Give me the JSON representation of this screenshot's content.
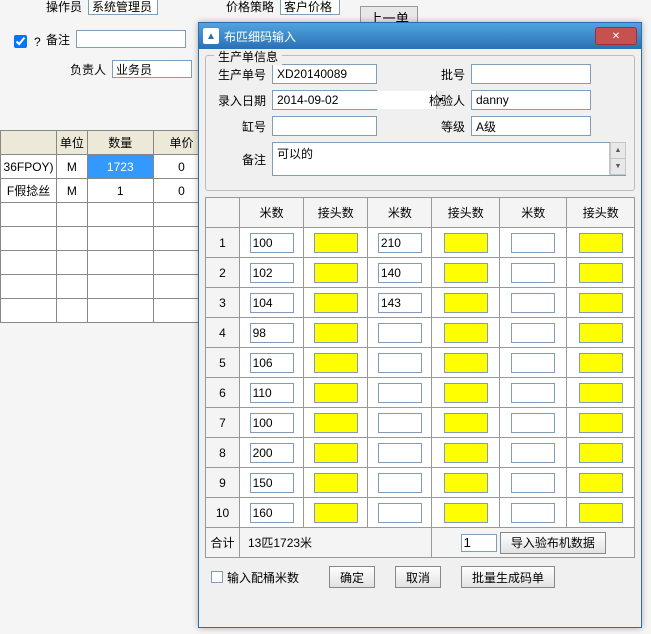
{
  "bg": {
    "operator_label": "操作员",
    "operator_value": "系统管理员",
    "price_strategy_label": "价格策略",
    "price_strategy_value": "客户价格",
    "prev_order_btn": "上一单",
    "checkbox_label": "?",
    "remark_label": "备注",
    "incharge_label": "负责人",
    "incharge_value": "业务员",
    "grid": {
      "headers": {
        "unit": "单位",
        "qty": "数量",
        "price": "单价"
      },
      "rows": [
        {
          "name": "36FPOY)",
          "unit": "M",
          "qty": "1723",
          "price": "0",
          "selected": true
        },
        {
          "name": "F假捻丝",
          "unit": "M",
          "qty": "1",
          "price": "0",
          "selected": false
        }
      ],
      "empty_rows": 5
    }
  },
  "dialog": {
    "title": "布匹细码输入",
    "groupbox_title": "生产单信息",
    "labels": {
      "prod_no": "生产单号",
      "batch_no": "批号",
      "entry_date": "录入日期",
      "inspector": "检验人",
      "vat_no": "缸号",
      "grade": "等级",
      "remark": "备注"
    },
    "values": {
      "prod_no": "XD20140089",
      "batch_no": "",
      "entry_date": "2014-09-02",
      "inspector": "danny",
      "vat_no": "",
      "grade": "A级",
      "remark": "可以的"
    },
    "grid_headers": {
      "meters": "米数",
      "joints": "接头数"
    },
    "rows": [
      {
        "idx": "1",
        "m1": "100",
        "j1": "",
        "m2": "210",
        "j2": "",
        "m3": "",
        "j3": ""
      },
      {
        "idx": "2",
        "m1": "102",
        "j1": "",
        "m2": "140",
        "j2": "",
        "m3": "",
        "j3": ""
      },
      {
        "idx": "3",
        "m1": "104",
        "j1": "",
        "m2": "143",
        "j2": "",
        "m3": "",
        "j3": ""
      },
      {
        "idx": "4",
        "m1": "98",
        "j1": "",
        "m2": "",
        "j2": "",
        "m3": "",
        "j3": ""
      },
      {
        "idx": "5",
        "m1": "106",
        "j1": "",
        "m2": "",
        "j2": "",
        "m3": "",
        "j3": ""
      },
      {
        "idx": "6",
        "m1": "110",
        "j1": "",
        "m2": "",
        "j2": "",
        "m3": "",
        "j3": ""
      },
      {
        "idx": "7",
        "m1": "100",
        "j1": "",
        "m2": "",
        "j2": "",
        "m3": "",
        "j3": ""
      },
      {
        "idx": "8",
        "m1": "200",
        "j1": "",
        "m2": "",
        "j2": "",
        "m3": "",
        "j3": ""
      },
      {
        "idx": "9",
        "m1": "150",
        "j1": "",
        "m2": "",
        "j2": "",
        "m3": "",
        "j3": ""
      },
      {
        "idx": "10",
        "m1": "160",
        "j1": "",
        "m2": "",
        "j2": "",
        "m3": "",
        "j3": ""
      }
    ],
    "summary": {
      "label": "合计",
      "text": "13匹1723米",
      "page": "1",
      "import_btn": "导入验布机数据"
    },
    "footer": {
      "allocate_chk": "输入配桶米数",
      "ok": "确定",
      "cancel": "取消",
      "batch_gen": "批量生成码单"
    }
  }
}
